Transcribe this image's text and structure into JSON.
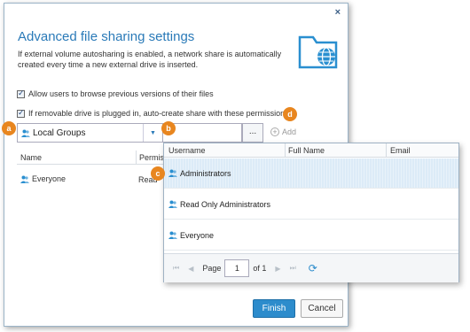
{
  "dialog": {
    "close_label": "×",
    "title": "Advanced file sharing settings",
    "description": "If external volume autosharing is enabled, a network share is automatically created every time a new external drive is inserted.",
    "checkbox1": "Allow users to browse previous versions of their files",
    "checkbox2": "If removable drive is plugged in, auto-create share with these permissions",
    "dropdown_value": "Local Groups",
    "ellipsis": "...",
    "add_label": "Add",
    "table": {
      "headers": [
        "Name",
        "Permissio"
      ],
      "rows": [
        {
          "name": "Everyone",
          "permission": "Read"
        }
      ]
    },
    "finish_label": "Finish",
    "cancel_label": "Cancel"
  },
  "popup": {
    "headers": [
      "Username",
      "Full Name",
      "Email"
    ],
    "rows": [
      "Administrators",
      "Read Only Administrators",
      "Everyone"
    ],
    "pager": {
      "page_label": "Page",
      "page_value": "1",
      "of_label": "of 1"
    }
  },
  "callouts": {
    "a": "a",
    "b": "b",
    "c": "c",
    "d": "d"
  },
  "colors": {
    "accent": "#2a7ab8",
    "callout": "#e8861f",
    "selected_row": "#dcebf7"
  }
}
